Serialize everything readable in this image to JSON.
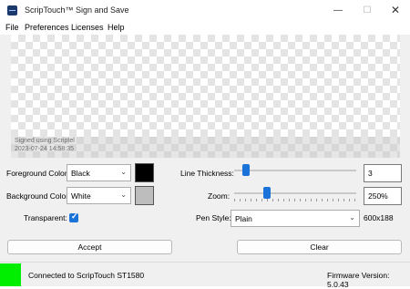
{
  "window": {
    "title": "ScripTouch™ Sign and Save",
    "controls": {
      "minimize": "—",
      "maximize": "☐",
      "close": "✕"
    }
  },
  "menu": [
    "File",
    "Preferences",
    "Licenses",
    "Help"
  ],
  "canvas": {
    "signed_line": "Signed using Scriptel",
    "timestamp_line": "2023-07-24 14:58:35"
  },
  "foreground": {
    "label": "Foreground Color:",
    "value": "Black",
    "swatch_color": "#000000"
  },
  "background": {
    "label": "Background Color:",
    "value": "White",
    "swatch_color": "#bdbdbd"
  },
  "transparent": {
    "label": "Transparent:",
    "checked": true,
    "check_glyph": "✓"
  },
  "line_thickness": {
    "label": "Line Thickness:",
    "value": "3",
    "slider_fraction": 0.1
  },
  "zoom": {
    "label": "Zoom:",
    "value": "250%",
    "slider_fraction": 0.27
  },
  "pen_style": {
    "label": "Pen Style:",
    "value": "Plain",
    "size_text": "600x188"
  },
  "buttons": {
    "accept": "Accept",
    "clear": "Clear"
  },
  "status": {
    "connected_text": "Connected to ScripTouch ST1580",
    "firmware_text": "Firmware Version: 5.0.43",
    "led_color": "#00ee00"
  },
  "icons": {
    "dropdown": "chevron-down-icon",
    "app": "scriptouch-app-icon"
  }
}
